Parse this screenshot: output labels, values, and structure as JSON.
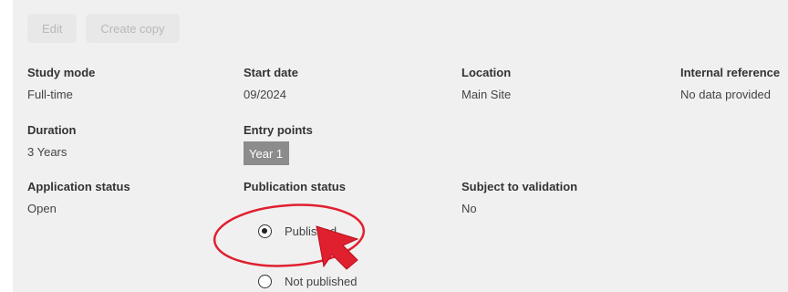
{
  "toolbar": {
    "edit_label": "Edit",
    "create_copy_label": "Create copy"
  },
  "details": {
    "study_mode": {
      "label": "Study mode",
      "value": "Full-time"
    },
    "start_date": {
      "label": "Start date",
      "value": "09/2024"
    },
    "location": {
      "label": "Location",
      "value": "Main Site"
    },
    "internal_reference": {
      "label": "Internal reference",
      "value": "No data provided"
    },
    "duration": {
      "label": "Duration",
      "value": "3 Years"
    },
    "entry_points": {
      "label": "Entry points",
      "value": "Year 1"
    },
    "application_status": {
      "label": "Application status",
      "value": "Open"
    },
    "publication_status": {
      "label": "Publication status",
      "options": [
        {
          "label": "Published",
          "selected": true
        },
        {
          "label": "Not published",
          "selected": false
        }
      ]
    },
    "subject_to_validation": {
      "label": "Subject to validation",
      "value": "No"
    }
  },
  "annotation": {
    "color": "#e0202f",
    "shapes": [
      "highlight-ellipse",
      "pointer-arrow"
    ]
  },
  "colors": {
    "panel_bg": "#f0f0f0",
    "chip_bg": "#8c8c8c"
  }
}
